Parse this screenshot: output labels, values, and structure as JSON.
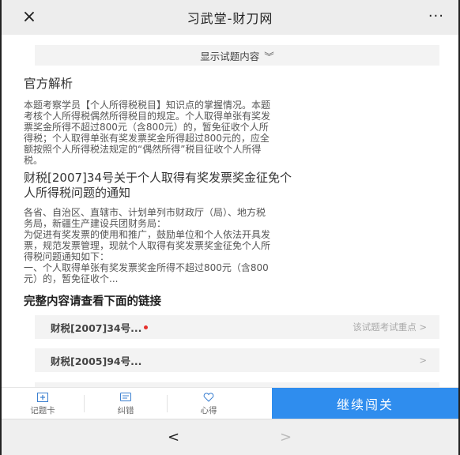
{
  "topbar": {
    "close_icon": "×",
    "title": "习武堂-财刀网",
    "more_icon": "···"
  },
  "show_question": {
    "label": "显示试题内容",
    "chevron": "︾"
  },
  "analysis": {
    "heading": "官方解析",
    "lines": [
      "本题考察学员【个人所得税税目】知识点的掌握情况。本题",
      "考核个人所得税偶然所得税目的规定。个人取得单张有奖发",
      "票奖金所得不超过800元（含800元）的，暂免征收个人所",
      "得税；个人取得单张有奖发票奖金所得超过800元的，应全",
      "额按照个人所得税法规定的“偶然所得”税目征收个人所得",
      "税。"
    ]
  },
  "notice": {
    "title_line1": "财税[2007]34号关于个人取得有奖发票奖金征免个",
    "title_line2": "人所得税问题的通知",
    "lines": [
      "各省、自治区、直辖市、计划单列市财政厅（局）、地方税",
      "务局，新疆生产建设兵团财务局：",
      "为促进有奖发票的使用和推广，鼓励单位和个人依法开具发",
      "票，规范发票管理，现就个人取得有奖发票奖金征免个人所",
      "得税问题通知如下：",
      "一、个人取得单张有奖发票奖金所得不超过800元（含800",
      "元）的，暂免征收个..."
    ]
  },
  "links": {
    "heading": "完整内容请查看下面的链接",
    "items": [
      {
        "label": "财税[2007]34号...",
        "hint": "该试题考试重点 >",
        "has_dot": true
      },
      {
        "label": "财税[2005]94号...",
        "hint": ">",
        "has_dot": false
      }
    ]
  },
  "actions": {
    "card": "记题卡",
    "correct": "纠错",
    "notes": "心得",
    "continue": "继续闯关"
  },
  "nav": {
    "back": "<",
    "forward": ">"
  },
  "colors": {
    "accent": "#2f8dee",
    "dot": "#e5302c"
  }
}
